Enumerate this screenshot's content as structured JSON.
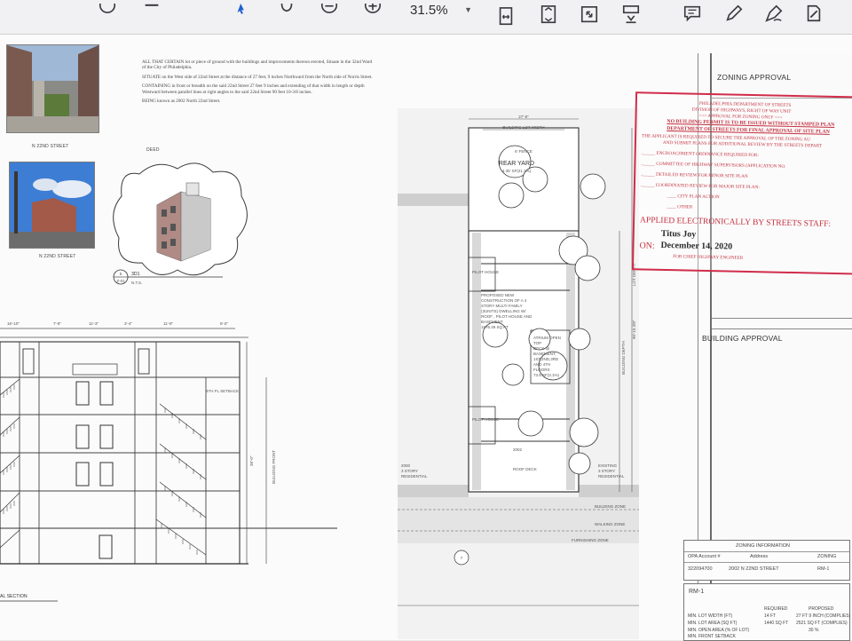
{
  "toolbar": {
    "zoom_value": "31.5%",
    "buttons": [
      {
        "name": "select-tool",
        "icon": "cursor-icon"
      },
      {
        "name": "hand-tool",
        "icon": "hand-icon"
      },
      {
        "name": "zoom-out",
        "icon": "zoom-out-icon"
      },
      {
        "name": "zoom-in",
        "icon": "zoom-in-icon"
      },
      {
        "name": "fit-width",
        "icon": "fit-width-icon"
      },
      {
        "name": "fit-page",
        "icon": "fit-page-icon"
      },
      {
        "name": "full-screen",
        "icon": "expand-icon"
      },
      {
        "name": "scroll-mode",
        "icon": "scroll-mode-icon"
      },
      {
        "name": "comment",
        "icon": "comment-icon"
      },
      {
        "name": "highlight",
        "icon": "pen-icon"
      },
      {
        "name": "draw",
        "icon": "draw-icon"
      },
      {
        "name": "fill-sign",
        "icon": "fill-sign-icon"
      }
    ]
  },
  "sheet": {
    "photo_captions": [
      "N 22ND STREET",
      "N 22ND STREET"
    ],
    "deed_label": "DEED",
    "legal_description": [
      "ALL THAT CERTAIN lot or piece of ground with the buildings and improvements thereon erected, Situate in the 32nd Ward of the City of Philadelphia.",
      "SITUATE on the West side of 22nd Street at the distance of 27 feet, 9 inches Northward from the North side of Norris Street.",
      "CONTAINING in front or breadth on the said 22nd Street 27 feet 9 inches and extending of that width in length or depth Westward between parallel lines at right angles to the said 22nd Street 90 feet 10-3/8 inches.",
      "BEING known as 2002 North 22nd Street."
    ],
    "view_tag": {
      "number": "5",
      "sheet": "Z-01",
      "label": "3D1",
      "scale": "N.T.S."
    },
    "elevation": {
      "dims_top": [
        "16'-10\"",
        "7'-8\"",
        "11'-3\"",
        "3'-4\"",
        "11'-9\"",
        "8'-0\""
      ],
      "setback_label": "4TH FL SETBACK",
      "building_front": "BUILDING FRONT",
      "height_dim": "38'-0\"",
      "section_label": "AL SECTION"
    },
    "site_plan": {
      "top_dim": "27'-9\"",
      "lot_width": "BUILDING LOT WIDTH",
      "fence": "6' FENCE",
      "rear_yard": "REAR YARD",
      "rear_yard_area": "4.35' SF(21.1%)",
      "pilot_house_top": "PILOT HOUSE",
      "proposed": [
        "PROPOSED NEW",
        "CONSTRUCTION OF A 4",
        "STORY MULTI FAMILY",
        "(3UNITS) DWELLING W/",
        "ROOF , PILOT HOUSE AND",
        "BASEMENT",
        "1876.49 SQ FT"
      ],
      "atrium": [
        "ATRIUM OPEN",
        "TOP",
        "DECK @",
        "BASEMENT,",
        "1ST,2ND,3RD",
        "AND 4TH",
        "FLOORS",
        "73.5 SF(3.1%)"
      ],
      "pilot_house_bottom": "PILOT HOUSE",
      "roof_deck": "ROOF DECK",
      "address_num": "2002",
      "left_neighbor": [
        "2000",
        "3 STORY",
        "RESIDENTIAL"
      ],
      "right_neighbor": [
        "EXISTING",
        "3 STORY",
        "RESIDENTIAL"
      ],
      "zones": [
        "BUILDING ZONE",
        "WALKING ZONE",
        "FURNISHING ZONE"
      ],
      "lot_depth": "90'-10 3/8\"",
      "lot_depth_label": "LOT DEPTH",
      "building_depth": "BUILDING DEPTH",
      "street_tag": "7"
    },
    "title_block": {
      "zoning_approval": "ZONING APPROVAL",
      "building_approval": "BUILDING APPROVAL",
      "zoning_information": "ZONING INFORMATION",
      "zi_headers": [
        "OPA Account #",
        "Address",
        "ZONING"
      ],
      "zi_values": [
        "322094700",
        "2002 N 22ND STREET",
        "RM-1"
      ],
      "rm_label": "RM-1",
      "rm_cols": [
        "REQUIRED",
        "PROPOSED"
      ],
      "rm_rows": [
        {
          "label": "MIN. LOT WIDTH (FT)",
          "req": "14 FT",
          "prop": "27 FT 9 INCH (COMPLIES)"
        },
        {
          "label": "MIN. LOT AREA (SQ FT)",
          "req": "1440 SQ FT",
          "prop": "2521 SQ FT (COMPLIES)"
        },
        {
          "label": "MIN. OPEN AREA (% OF LOT)",
          "req": "",
          "prop": "30 %"
        },
        {
          "label": "MIN. FRONT SETBACK",
          "req": "",
          "prop": ""
        }
      ]
    },
    "stamp": {
      "lines": [
        "PHILADELPHIA DEPARTMENT OF STREETS",
        "DIVISION OF HIGHWAYS, RIGHT OF WAY UNIT",
        ">>> APPROVAL FOR ZONING ONLY <<<",
        "NO BUILDING PERMIT IS TO BE ISSUED WITHOUT STAMPED PLAN",
        "DEPARTMENT OF STREETS FOR FINAL APPROVAL OF SITE PLAN",
        "THE APPLICANT IS REQUIRED TO SECURE THE APPROVAL OF THE ZONING AU",
        "AND SUBMIT PLANS FOR ADDITIONAL REVIEW BY THE STREETS DEPART"
      ],
      "checks": [
        "ENCROACHMENT ORDINANCE REQUIRED FOR:",
        "COMMITTEE OF HIGHWAY SUPERVISORS (APPLICATION NO.",
        "DETAILED REVIEW FOR MINOR SITE PLAN",
        "COORDINATED REVIEW FOR MAJOR SITE PLAN:",
        "CITY PLAN ACTION",
        "OTHER"
      ],
      "applied": "APPLIED ELECTRONICALLY BY STREETS STAFF:",
      "name": "Titus Joy",
      "on_label": "ON:",
      "date": "December 14, 2020",
      "engineer": "FOR CHIEF HIGHWAY ENGINEER"
    }
  }
}
